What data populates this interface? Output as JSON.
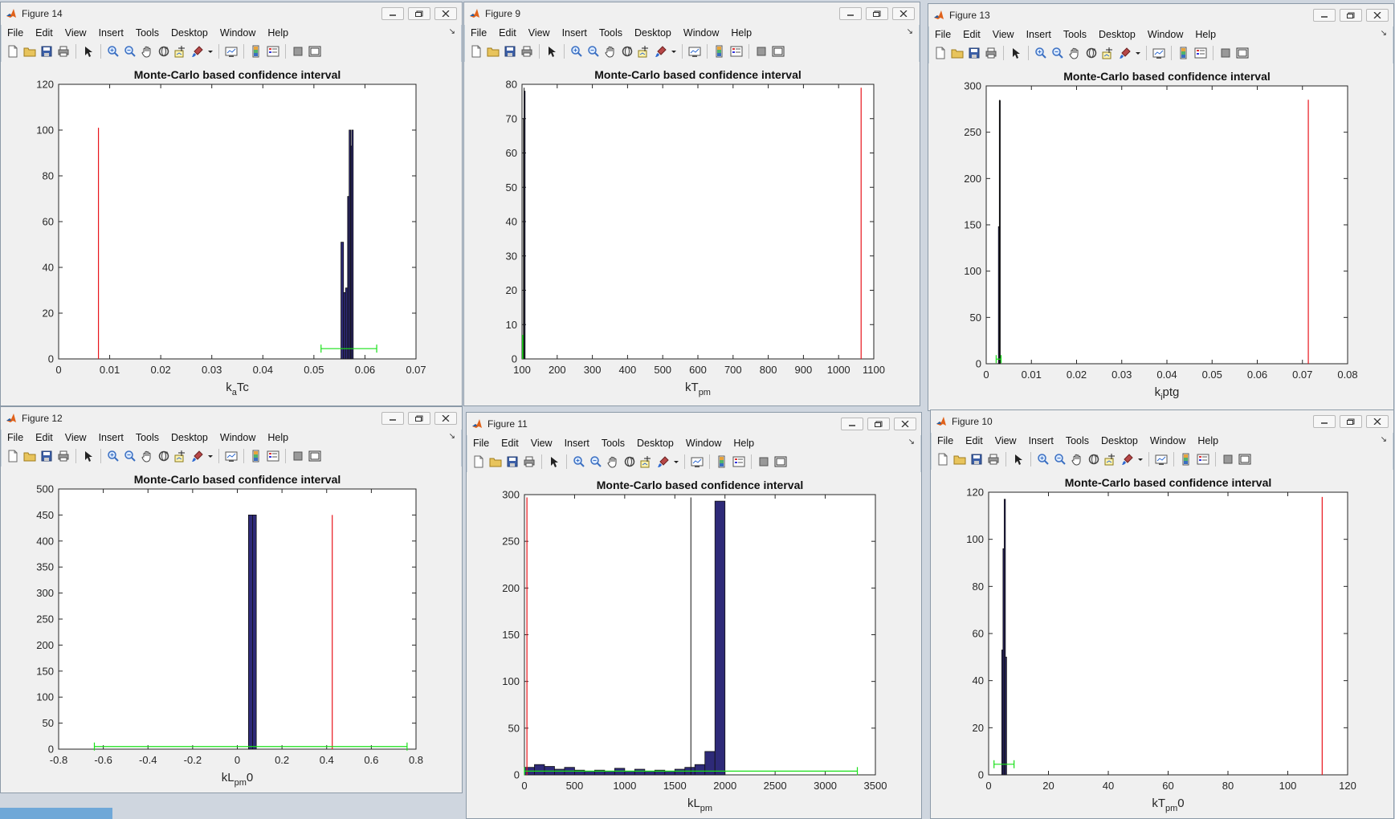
{
  "menus": [
    "File",
    "Edit",
    "View",
    "Insert",
    "Tools",
    "Desktop",
    "Window",
    "Help"
  ],
  "toolbar_icons": [
    "new-figure-icon",
    "open-file-icon",
    "save-icon",
    "print-icon",
    "select-arrow-icon",
    "zoom-in-icon",
    "zoom-out-icon",
    "pan-hand-icon",
    "rotate-3d-icon",
    "data-cursor-icon",
    "brush-icon",
    "brush-dropdown-icon",
    "link-plot-icon",
    "colorbar-icon",
    "legend-icon",
    "hide-plot-tools-icon",
    "show-plot-tools-icon"
  ],
  "colors": {
    "bar_fill": "#2e2a78",
    "bar_edge": "#111111",
    "red_line": "#e8141b",
    "green_interval": "#19e019",
    "window_bg": "#f0f0f0",
    "axes_bg": "#ffffff"
  },
  "windows": [
    {
      "title": "Figure 14",
      "chart_data": {
        "type": "bar",
        "title": "Monte-Carlo based confidence interval",
        "xlabel": "k_aTc",
        "ylabel": "",
        "xlim": [
          0,
          0.07
        ],
        "ylim": [
          0,
          120
        ],
        "xticks": [
          0,
          0.01,
          0.02,
          0.03,
          0.04,
          0.05,
          0.06,
          0.07
        ],
        "xtick_labels": [
          "0",
          "0.01",
          "0.02",
          "0.03",
          "0.04",
          "0.05",
          "0.06",
          "0.07"
        ],
        "yticks": [
          0,
          20,
          40,
          60,
          80,
          100,
          120
        ],
        "ytick_labels": [
          "0",
          "20",
          "40",
          "60",
          "80",
          "100",
          "120"
        ],
        "bins": [
          {
            "x0": 0.0553,
            "x1": 0.0558,
            "y": 51
          },
          {
            "x0": 0.0558,
            "x1": 0.0562,
            "y": 29
          },
          {
            "x0": 0.0562,
            "x1": 0.0566,
            "y": 31
          },
          {
            "x0": 0.0566,
            "x1": 0.0569,
            "y": 71
          },
          {
            "x0": 0.0569,
            "x1": 0.0572,
            "y": 100
          },
          {
            "x0": 0.0572,
            "x1": 0.0574,
            "y": 93
          },
          {
            "x0": 0.0574,
            "x1": 0.0577,
            "y": 100
          }
        ],
        "red_lines": [
          {
            "x": 0.0078,
            "y_top": 101
          }
        ],
        "black_lines": [],
        "green_interval": {
          "x0": 0.0514,
          "x1": 0.0623,
          "y": 4.5
        }
      }
    },
    {
      "title": "Figure 9",
      "chart_data": {
        "type": "bar",
        "title": "Monte-Carlo based confidence interval",
        "xlabel": "kT_pm",
        "ylabel": "",
        "xlim": [
          100,
          1100
        ],
        "ylim": [
          0,
          80
        ],
        "xticks": [
          100,
          200,
          300,
          400,
          500,
          600,
          700,
          800,
          900,
          1000,
          1100
        ],
        "xtick_labels": [
          "100",
          "200",
          "300",
          "400",
          "500",
          "600",
          "700",
          "800",
          "900",
          "1000",
          "1100"
        ],
        "yticks": [
          0,
          10,
          20,
          30,
          40,
          50,
          60,
          70,
          80
        ],
        "ytick_labels": [
          "0",
          "10",
          "20",
          "30",
          "40",
          "50",
          "60",
          "70",
          "80"
        ],
        "bins": [
          {
            "x0": 104,
            "x1": 106,
            "y": 70
          },
          {
            "x0": 106,
            "x1": 108,
            "y": 78
          }
        ],
        "red_lines": [
          {
            "x": 1064,
            "y_top": 79
          }
        ],
        "black_lines": [
          {
            "x": 106,
            "y_top": 79
          }
        ],
        "green_interval": {
          "x0": 100,
          "x1": 104,
          "y": 4,
          "vertical": true,
          "y0": 0,
          "y1": 7
        }
      }
    },
    {
      "title": "Figure 13",
      "chart_data": {
        "type": "bar",
        "title": "Monte-Carlo based confidence interval",
        "xlabel": "k_iptg",
        "ylabel": "",
        "xlim": [
          0,
          0.08
        ],
        "ylim": [
          0,
          300
        ],
        "xticks": [
          0,
          0.01,
          0.02,
          0.03,
          0.04,
          0.05,
          0.06,
          0.07,
          0.08
        ],
        "xtick_labels": [
          "0",
          "0.01",
          "0.02",
          "0.03",
          "0.04",
          "0.05",
          "0.06",
          "0.07",
          "0.08"
        ],
        "yticks": [
          0,
          50,
          100,
          150,
          200,
          250,
          300
        ],
        "ytick_labels": [
          "0",
          "50",
          "100",
          "150",
          "200",
          "250",
          "300"
        ],
        "bins": [
          {
            "x0": 0.0027,
            "x1": 0.0029,
            "y": 148
          },
          {
            "x0": 0.0029,
            "x1": 0.0031,
            "y": 284
          }
        ],
        "red_lines": [
          {
            "x": 0.0713,
            "y_top": 285
          }
        ],
        "black_lines": [
          {
            "x": 0.003,
            "y_top": 285
          }
        ],
        "green_interval": {
          "x0": 0.0022,
          "x1": 0.0033,
          "y": 5
        }
      }
    },
    {
      "title": "Figure 12",
      "chart_data": {
        "type": "bar",
        "title": "Monte-Carlo based confidence interval",
        "xlabel": "kL_pm0",
        "ylabel": "",
        "xlim": [
          -0.8,
          0.8
        ],
        "ylim": [
          0,
          500
        ],
        "xticks": [
          -0.8,
          -0.6,
          -0.4,
          -0.2,
          0,
          0.2,
          0.4,
          0.6,
          0.8
        ],
        "xtick_labels": [
          "-0.8",
          "-0.6",
          "-0.4",
          "-0.2",
          "0",
          "0.2",
          "0.4",
          "0.6",
          "0.8"
        ],
        "yticks": [
          0,
          50,
          100,
          150,
          200,
          250,
          300,
          350,
          400,
          450,
          500
        ],
        "ytick_labels": [
          "0",
          "50",
          "100",
          "150",
          "200",
          "250",
          "300",
          "350",
          "400",
          "450",
          "500"
        ],
        "bins": [
          {
            "x0": 0.05,
            "x1": 0.068,
            "y": 450
          },
          {
            "x0": 0.068,
            "x1": 0.085,
            "y": 450
          }
        ],
        "red_lines": [
          {
            "x": 0.425,
            "y_top": 450
          }
        ],
        "black_lines": [],
        "green_interval": {
          "x0": -0.64,
          "x1": 0.76,
          "y": 5
        }
      }
    },
    {
      "title": "Figure 11",
      "chart_data": {
        "type": "bar",
        "title": "Monte-Carlo based confidence interval",
        "xlabel": "kL_pm",
        "ylabel": "",
        "xlim": [
          0,
          3500
        ],
        "ylim": [
          0,
          300
        ],
        "xticks": [
          0,
          500,
          1000,
          1500,
          2000,
          2500,
          3000,
          3500
        ],
        "xtick_labels": [
          "0",
          "500",
          "1000",
          "1500",
          "2000",
          "2500",
          "3000",
          "3500"
        ],
        "yticks": [
          0,
          50,
          100,
          150,
          200,
          250,
          300
        ],
        "ytick_labels": [
          "0",
          "50",
          "100",
          "150",
          "200",
          "250",
          "300"
        ],
        "bins": [
          {
            "x0": 0,
            "x1": 100,
            "y": 8
          },
          {
            "x0": 100,
            "x1": 200,
            "y": 11
          },
          {
            "x0": 200,
            "x1": 300,
            "y": 9
          },
          {
            "x0": 300,
            "x1": 400,
            "y": 6
          },
          {
            "x0": 400,
            "x1": 500,
            "y": 8
          },
          {
            "x0": 500,
            "x1": 600,
            "y": 5
          },
          {
            "x0": 600,
            "x1": 700,
            "y": 4
          },
          {
            "x0": 700,
            "x1": 800,
            "y": 5
          },
          {
            "x0": 800,
            "x1": 900,
            "y": 4
          },
          {
            "x0": 900,
            "x1": 1000,
            "y": 7
          },
          {
            "x0": 1000,
            "x1": 1100,
            "y": 4
          },
          {
            "x0": 1100,
            "x1": 1200,
            "y": 6
          },
          {
            "x0": 1200,
            "x1": 1300,
            "y": 4
          },
          {
            "x0": 1300,
            "x1": 1400,
            "y": 5
          },
          {
            "x0": 1400,
            "x1": 1500,
            "y": 4
          },
          {
            "x0": 1500,
            "x1": 1600,
            "y": 6
          },
          {
            "x0": 1600,
            "x1": 1700,
            "y": 8
          },
          {
            "x0": 1700,
            "x1": 1800,
            "y": 11
          },
          {
            "x0": 1800,
            "x1": 1900,
            "y": 25
          },
          {
            "x0": 1900,
            "x1": 2000,
            "y": 293
          }
        ],
        "red_lines": [
          {
            "x": 25,
            "y_top": 297
          }
        ],
        "black_lines": [
          {
            "x": 1660,
            "y_top": 297
          }
        ],
        "green_interval": {
          "x0": 0,
          "x1": 3320,
          "y": 4
        }
      }
    },
    {
      "title": "Figure 10",
      "chart_data": {
        "type": "bar",
        "title": "Monte-Carlo based confidence interval",
        "xlabel": "kT_pm0",
        "ylabel": "",
        "xlim": [
          0,
          120
        ],
        "ylim": [
          0,
          120
        ],
        "xticks": [
          0,
          20,
          40,
          60,
          80,
          100,
          120
        ],
        "xtick_labels": [
          "0",
          "20",
          "40",
          "60",
          "80",
          "100",
          "120"
        ],
        "yticks": [
          0,
          20,
          40,
          60,
          80,
          100,
          120
        ],
        "ytick_labels": [
          "0",
          "20",
          "40",
          "60",
          "80",
          "100",
          "120"
        ],
        "bins": [
          {
            "x0": 4.4,
            "x1": 4.8,
            "y": 53
          },
          {
            "x0": 4.8,
            "x1": 5.2,
            "y": 96
          },
          {
            "x0": 5.2,
            "x1": 5.6,
            "y": 117
          },
          {
            "x0": 5.6,
            "x1": 6.0,
            "y": 50
          }
        ],
        "red_lines": [
          {
            "x": 111.5,
            "y_top": 118
          }
        ],
        "black_lines": [],
        "green_interval": {
          "x0": 1.8,
          "x1": 8.5,
          "y": 4.5
        }
      }
    }
  ]
}
